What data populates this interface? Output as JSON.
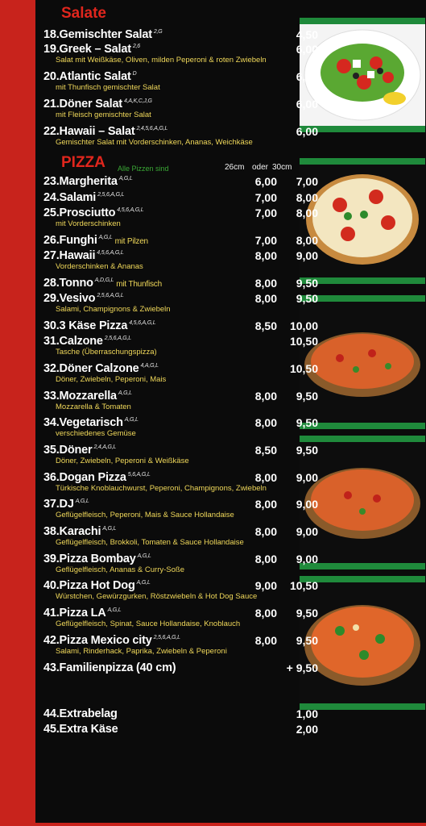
{
  "sections": {
    "salate_title": "Salate",
    "pizza_title": "PIZZA",
    "pizza_note": "Alle Pizzen sind",
    "size1": "26cm",
    "size_mid": "oder",
    "size2": "30cm"
  },
  "salads": [
    {
      "name": "18.Gemischter Salat",
      "allergen": "2,G",
      "price": "4,50",
      "desc": ""
    },
    {
      "name": "19.Greek – Salat",
      "allergen": "2,6",
      "price": "6,00",
      "desc": "Salat mit Weißkäse, Oliven, milden Peperoni & roten Zwiebeln"
    },
    {
      "name": "20.Atlantic Salat",
      "allergen": "D",
      "price": "6,00",
      "desc": "mit Thunfisch gemischter Salat"
    },
    {
      "name": "21.Döner Salat",
      "allergen": "4,A,K,C,J,G",
      "price": "6,00",
      "desc": "mit Fleisch gemischter Salat"
    },
    {
      "name": "22.Hawaii – Salat",
      "allergen": "2,4,5,6,A,G,L",
      "price": "6,00",
      "desc": "Gemischter Salat mit Vorderschinken, Ananas, Weichkäse"
    }
  ],
  "pizzas": [
    {
      "name": "23.Margherita",
      "allergen": "A,G,L",
      "inline": "",
      "p1": "6,00",
      "p2": "7,00",
      "desc": ""
    },
    {
      "name": "24.Salami",
      "allergen": "2,5,6,A,G,L",
      "inline": "",
      "p1": "7,00",
      "p2": "8,00",
      "desc": ""
    },
    {
      "name": "25.Prosciutto",
      "allergen": "4,5,6,A,G,L",
      "inline": "",
      "p1": "7,00",
      "p2": "8,00",
      "desc": "mit Vorderschinken"
    },
    {
      "name": "26.Funghi",
      "allergen": "A,G,L",
      "inline": "mit Pilzen",
      "p1": "7,00",
      "p2": "8,00",
      "desc": ""
    },
    {
      "name": "27.Hawaii",
      "allergen": "4,5,6,A,G,L",
      "inline": "",
      "p1": "8,00",
      "p2": "9,00",
      "desc": "Vorderschinken & Ananas"
    },
    {
      "name": "28.Tonno",
      "allergen": "A,D,G,L",
      "inline": "mit Thunfisch",
      "p1": "8,00",
      "p2": "9,50",
      "desc": ""
    },
    {
      "name": "29.Vesivo",
      "allergen": "2,5,6,A,G,L",
      "inline": "",
      "p1": "8,00",
      "p2": "9,50",
      "desc": "Salami, Champignons & Zwiebeln"
    },
    {
      "name": "30.3 Käse Pizza",
      "allergen": "4,5,6,A,G,L",
      "inline": "",
      "p1": "8,50",
      "p2": "10,00",
      "desc": ""
    },
    {
      "name": "31.Calzone",
      "allergen": "2,5,6,A,G,L",
      "inline": "",
      "p1": "",
      "p2": "10,50",
      "desc": "Tasche (Überraschungspizza)"
    },
    {
      "name": "32.Döner Calzone",
      "allergen": "4,A,G,L",
      "inline": "",
      "p1": "",
      "p2": "10,50",
      "desc": "Döner, Zwiebeln, Peperoni, Mais"
    },
    {
      "name": "33.Mozzarella",
      "allergen": "A,G,L",
      "inline": "",
      "p1": "8,00",
      "p2": "9,50",
      "desc": "Mozzarella & Tomaten"
    },
    {
      "name": "34.Vegetarisch",
      "allergen": "A,G,L",
      "inline": "",
      "p1": "8,00",
      "p2": "9,50",
      "desc": "verschiedenes Gemüse"
    },
    {
      "name": "35.Döner",
      "allergen": "2,4,A,G,L",
      "inline": "",
      "p1": "8,50",
      "p2": "9,50",
      "desc": "Döner, Zwiebeln, Peperoni & Weißkäse"
    },
    {
      "name": "36.Dogan Pizza",
      "allergen": "5,6,A,G,L",
      "inline": "",
      "p1": "8,00",
      "p2": "9,00",
      "desc": "Türkische Knoblauchwurst, Peperoni, Champignons, Zwiebeln"
    },
    {
      "name": "37.DJ",
      "allergen": "A,G,L",
      "inline": "",
      "p1": "8,00",
      "p2": "9,00",
      "desc": "Geflügelfleisch, Peperoni, Mais & Sauce Hollandaise"
    },
    {
      "name": "38.Karachi",
      "allergen": "A,G,L",
      "inline": "",
      "p1": "8,00",
      "p2": "9,00",
      "desc": "Geflügelfleisch, Brokkoli, Tomaten & Sauce Hollandaise"
    },
    {
      "name": "39.Pizza Bombay",
      "allergen": "A,G,L",
      "inline": "",
      "p1": "8,00",
      "p2": "9,00",
      "desc": "Geflügelfleisch, Ananas & Curry-Soße"
    },
    {
      "name": "40.Pizza Hot Dog",
      "allergen": "A,G,L",
      "inline": "",
      "p1": "9,00",
      "p2": "10,50",
      "desc": "Würstchen, Gewürzgurken, Röstzwiebeln & Hot Dog Sauce"
    },
    {
      "name": "41.Pizza LA",
      "allergen": "A,G,L",
      "inline": "",
      "p1": "8,00",
      "p2": "9,50",
      "desc": "Geflügelfleisch, Spinat, Sauce Hollandaise, Knoblauch"
    },
    {
      "name": "42.Pizza Mexico city",
      "allergen": "2,5,6,A,G,L",
      "inline": "",
      "p1": "8,00",
      "p2": "9,50",
      "desc": "Salami, Rinderhack, Paprika, Zwiebeln & Peperoni"
    },
    {
      "name": "43.Familienpizza (40 cm)",
      "allergen": "",
      "inline": "",
      "p1": "",
      "p2": "+ 9,50",
      "desc": ""
    }
  ],
  "extras": [
    {
      "name": "44.Extrabelag",
      "price": "1,00"
    },
    {
      "name": "45.Extra Käse",
      "price": "2,00"
    }
  ]
}
